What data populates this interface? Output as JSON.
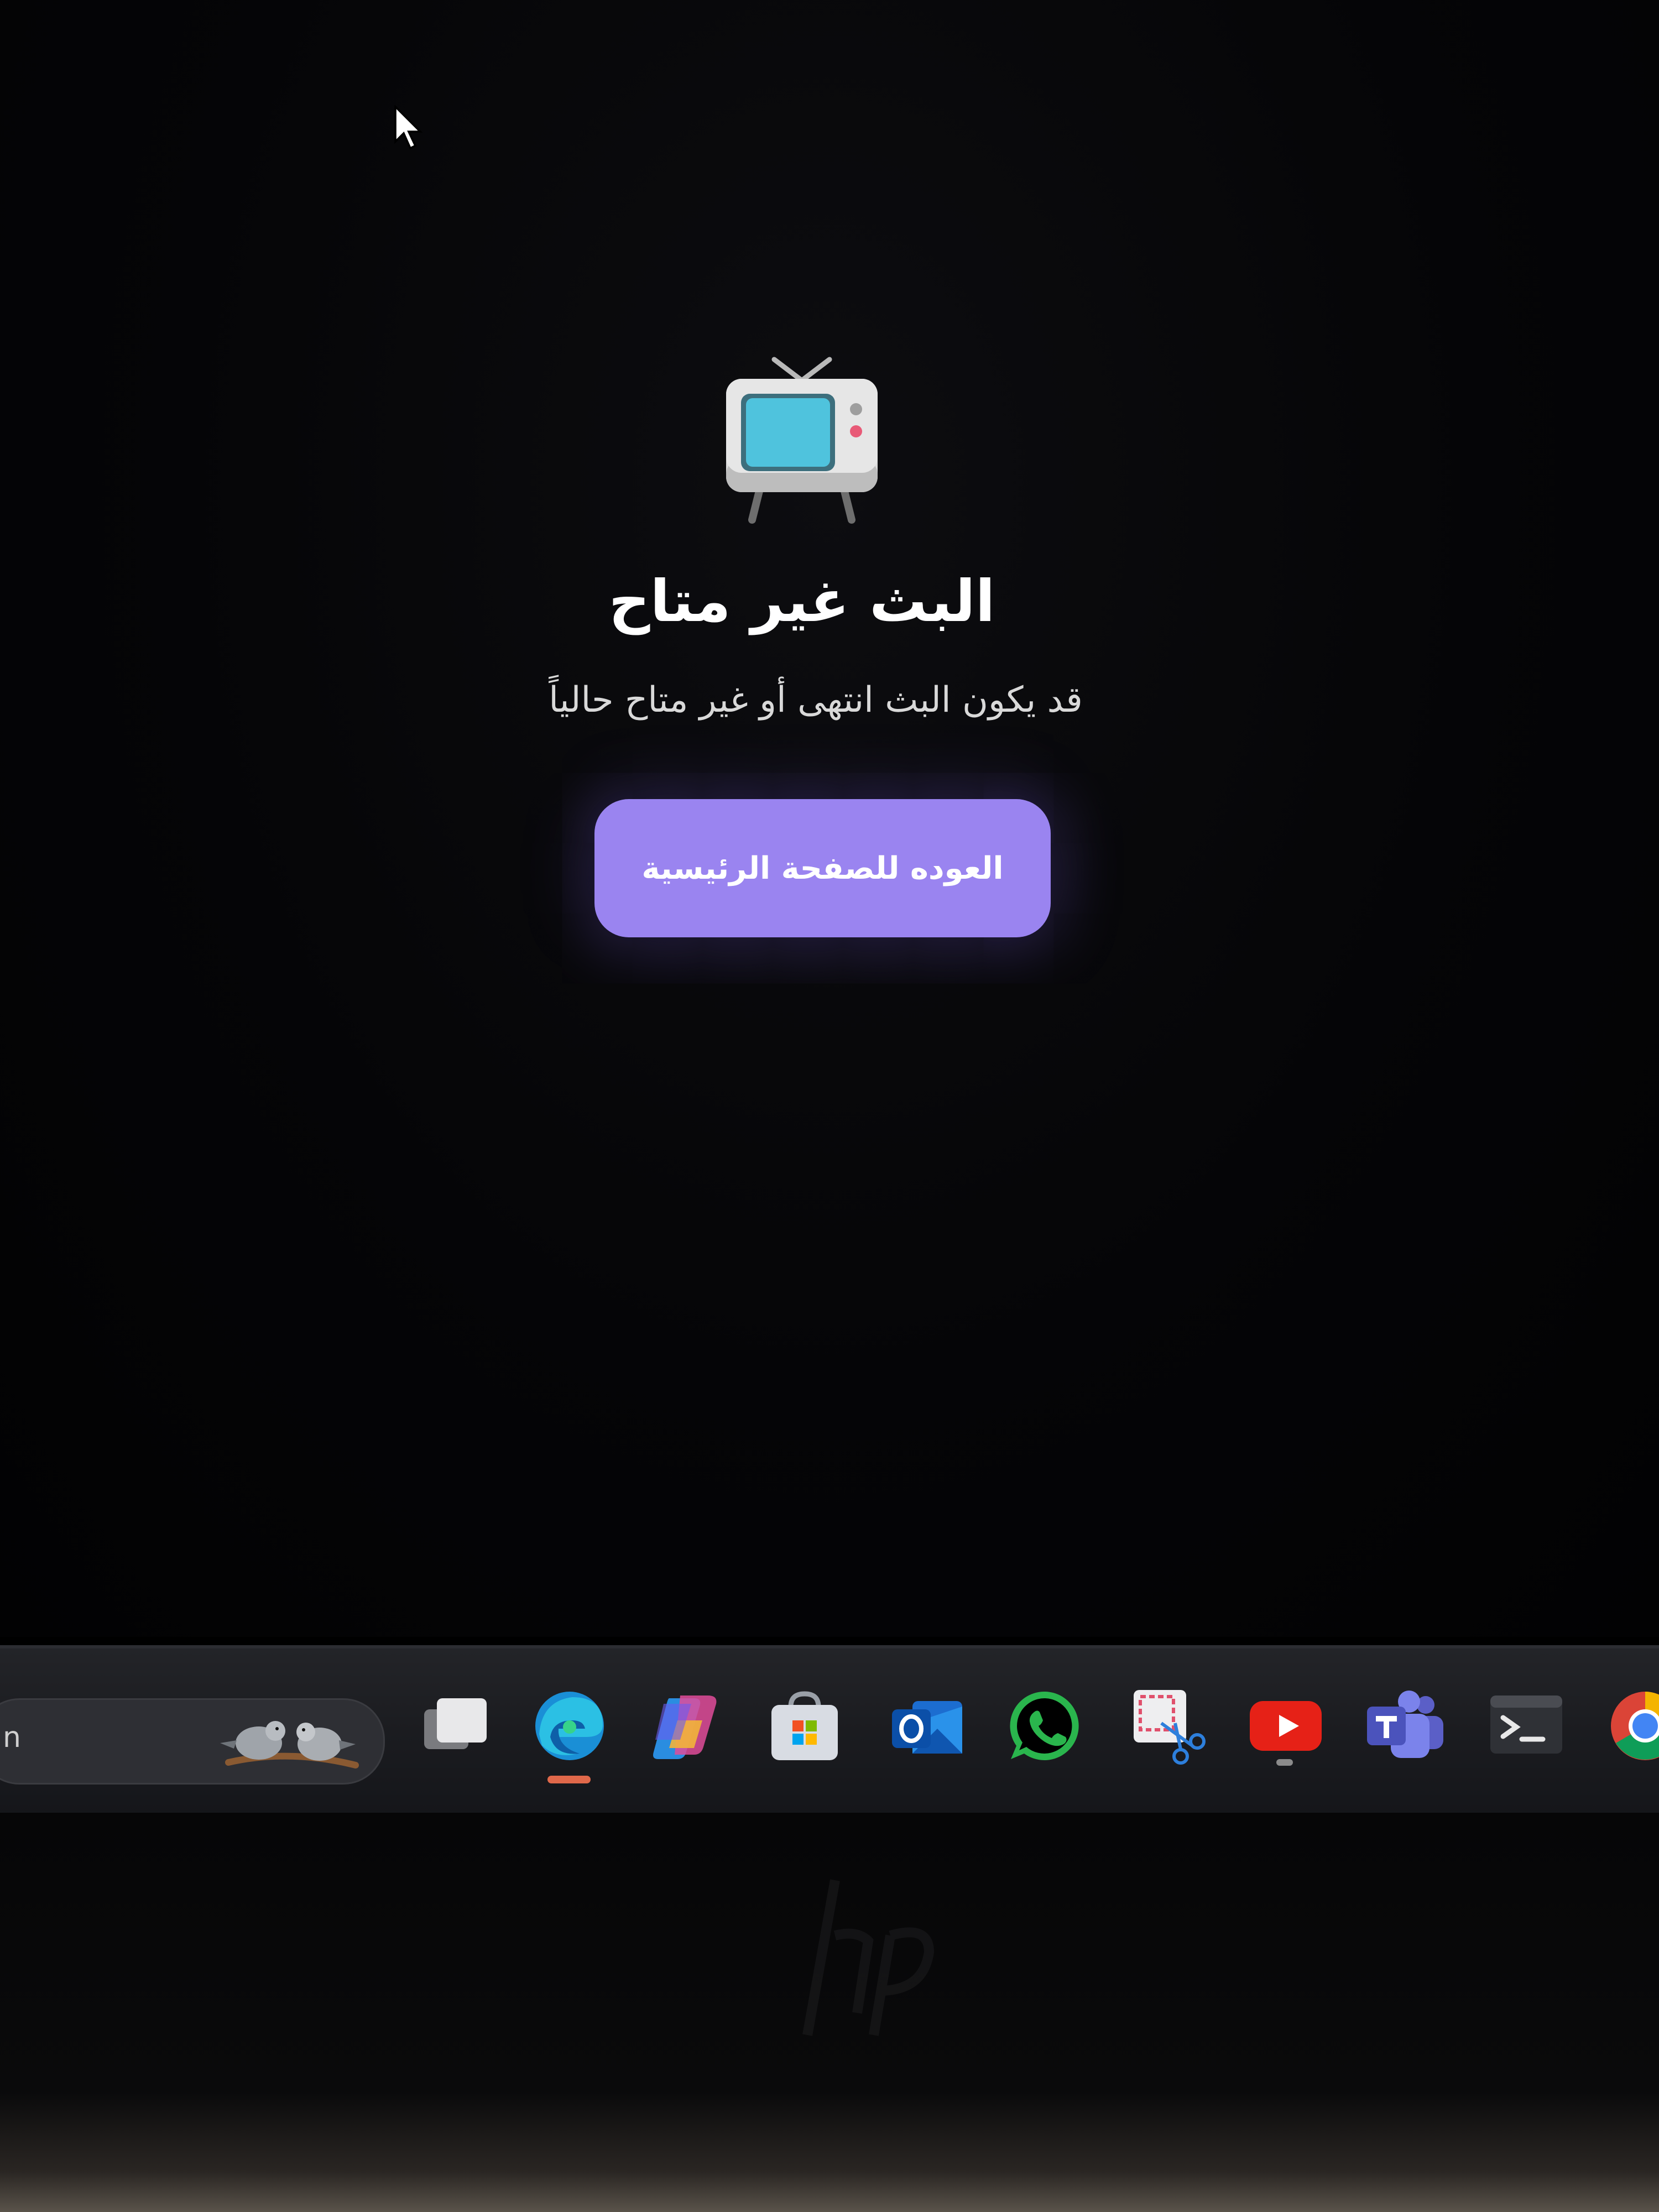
{
  "page": {
    "title": "البث غير متاح",
    "subtitle": "قد يكون البث انتهى أو غير متاح حالياً",
    "home_button_label": "العوده للصفحة الرئيسية",
    "icon": "tv-icon"
  },
  "taskbar": {
    "search_text": "n",
    "widget_icon": "birds-icon",
    "apps": [
      {
        "name": "task-view-icon"
      },
      {
        "name": "edge-icon",
        "active": true
      },
      {
        "name": "copilot-icon"
      },
      {
        "name": "microsoft-store-icon"
      },
      {
        "name": "outlook-icon"
      },
      {
        "name": "whatsapp-icon"
      },
      {
        "name": "snipping-tool-icon"
      },
      {
        "name": "youtube-icon",
        "running": true
      },
      {
        "name": "teams-icon"
      },
      {
        "name": "terminal-icon"
      },
      {
        "name": "chrome-icon"
      }
    ]
  },
  "colors": {
    "background": "#000000",
    "button": "#9a84f0",
    "text": "#ffffff",
    "active_indicator": "#e0684a"
  }
}
